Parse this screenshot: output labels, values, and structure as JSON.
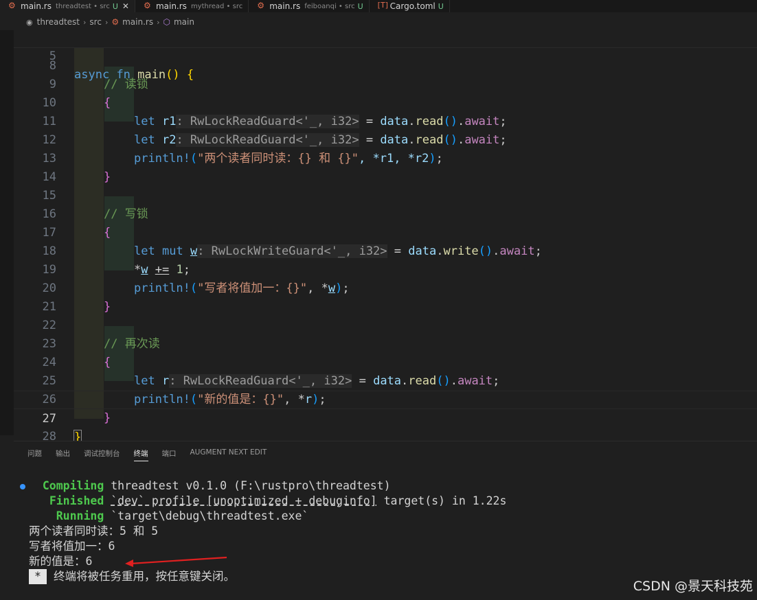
{
  "tabs": [
    {
      "name": "main.rs",
      "desc": "threadtest • src",
      "modified": "U",
      "icon": "rust-icon",
      "active": true,
      "close": "✕"
    },
    {
      "name": "main.rs",
      "desc": "mythread • src",
      "modified": "",
      "icon": "rust-icon",
      "active": false
    },
    {
      "name": "main.rs",
      "desc": "feiboanqi • src",
      "modified": "U",
      "icon": "rust-icon",
      "active": false
    },
    {
      "name": "Cargo.toml",
      "desc": "",
      "modified": "U",
      "icon": "toml-icon",
      "active": false
    }
  ],
  "breadcrumb": [
    "threadtest",
    "src",
    "main.rs",
    "main"
  ],
  "sticky": {
    "line": "5",
    "kw1": "async",
    "kw2": "fn",
    "name": "main",
    "rest": "() {"
  },
  "lines": {
    "l8": "8",
    "l8_comment": "// 读锁",
    "l9": "9",
    "l10": "10",
    "l11": "11",
    "l12": "12",
    "l13": "13",
    "l14": "14",
    "l15": "15",
    "l15_comment": "// 写锁",
    "l16": "16",
    "l17": "17",
    "l18": "18",
    "l19": "19",
    "l20": "20",
    "l21": "21",
    "l22": "22",
    "l22_comment": "// 再次读",
    "l23": "23",
    "l24": "24",
    "l25": "25",
    "l26": "26",
    "l27": "27",
    "l28": "28",
    "let": "let",
    "mut": "mut",
    "r1": "r1",
    "r2": "r2",
    "w": "w",
    "r": "r",
    "hint_read": ": RwLockReadGuard<'_, i32>",
    "hint_write": ": RwLockWriteGuard<'_, i32>",
    "data": "data",
    "read": "read",
    "write": "write",
    "await": "await",
    "println": "println!",
    "str12": "\"两个读者同时读：{} 和 {}\"",
    "str19": "\"写者将值加一：{}\"",
    "str25": "\"新的值是：{}\"",
    "args12": ", *r1, *r2",
    "one": "1"
  },
  "panel": {
    "tabs": [
      "问题",
      "输出",
      "调试控制台",
      "终端",
      "端口",
      "AUGMENT NEXT EDIT"
    ],
    "active_tab": "终端"
  },
  "terminal": {
    "compiling": "Compiling",
    "compiling_rest": " threadtest v0.1.0 (F:\\rustpro\\threadtest)",
    "finished": "Finished",
    "finished_profile": "`dev` profile [unoptimized + debuginfo]",
    "finished_rest": " target(s) in 1.22s",
    "running": "Running",
    "running_rest": " `target\\debug\\threadtest.exe`",
    "out1": "两个读者同时读：5 和 5",
    "out2": "写者将值加一：6",
    "out3": "新的值是：6",
    "star": "*",
    "closing": "终端将被任务重用，按任意键关闭。"
  },
  "watermark": "CSDN @景天科技苑",
  "colors": {
    "keyword": "#569cd6",
    "function": "#dcdcaa",
    "string": "#ce9178",
    "comment": "#6a9955",
    "green": "#4ec94e"
  }
}
